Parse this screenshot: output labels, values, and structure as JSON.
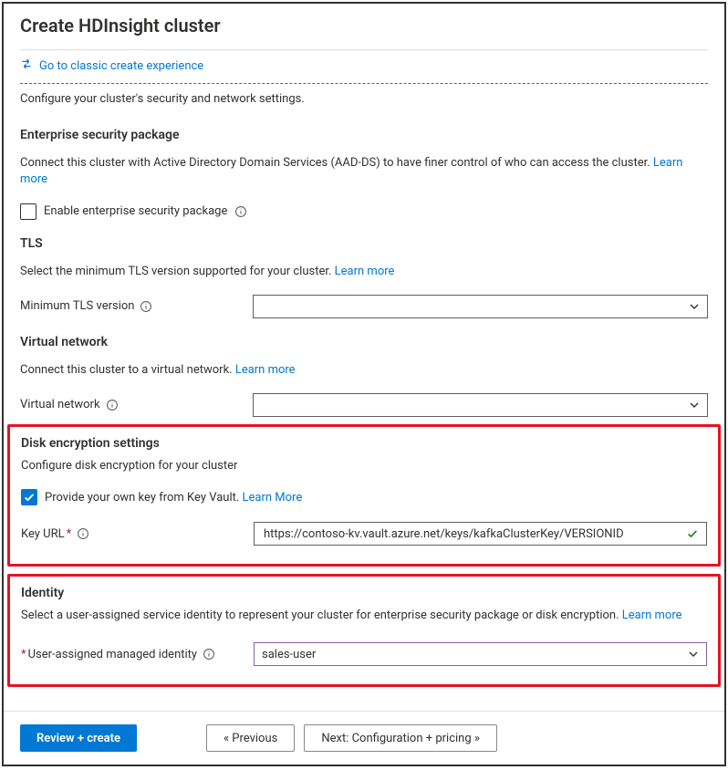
{
  "page": {
    "title": "Create HDInsight cluster",
    "classic_link": "Go to classic create experience",
    "intro": "Configure your cluster's security and network settings."
  },
  "esp": {
    "title": "Enterprise security package",
    "desc": "Connect this cluster with Active Directory Domain Services (AAD-DS) to have finer control of who can access the cluster. ",
    "learn_more": "Learn more",
    "checkbox_label": "Enable enterprise security package"
  },
  "tls": {
    "title": "TLS",
    "desc": "Select the minimum TLS version supported for your cluster. ",
    "learn_more": "Learn more",
    "label": "Minimum TLS version",
    "value": ""
  },
  "vnet": {
    "title": "Virtual network",
    "desc": "Connect this cluster to a virtual network. ",
    "learn_more": "Learn more",
    "label": "Virtual network",
    "value": ""
  },
  "disk": {
    "title": "Disk encryption settings",
    "desc": "Configure disk encryption for your cluster",
    "checkbox_label": "Provide your own key from Key Vault. ",
    "learn_more": "Learn More",
    "key_url_label": "Key URL",
    "key_url_value": "https://contoso-kv.vault.azure.net/keys/kafkaClusterKey/VERSIONID"
  },
  "identity": {
    "title": "Identity",
    "desc": "Select a user-assigned service identity to represent your cluster for enterprise security package or disk encryption. ",
    "learn_more": "Learn more",
    "label": "User-assigned managed identity",
    "value": "sales-user"
  },
  "footer": {
    "review": "Review + create",
    "previous": "« Previous",
    "next": "Next: Configuration + pricing »"
  }
}
